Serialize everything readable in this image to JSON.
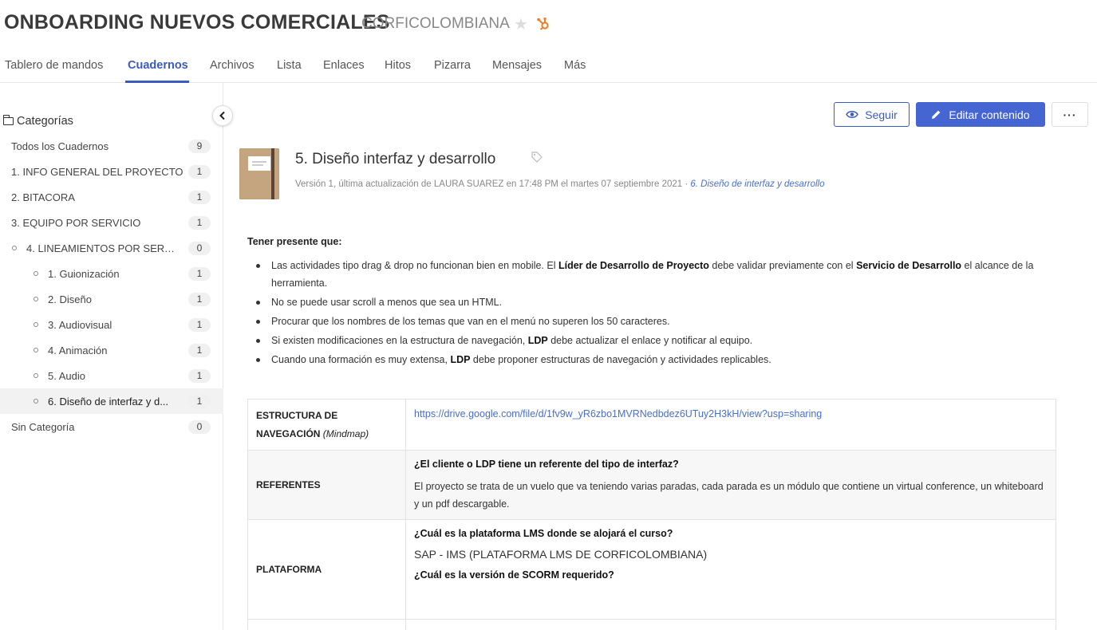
{
  "header": {
    "project_title": "ONBOARDING NUEVOS COMERCIALES",
    "company": "CORFICOLOMBIANA"
  },
  "tabs": [
    {
      "label": "Tablero de mandos"
    },
    {
      "label": "Cuadernos"
    },
    {
      "label": "Archivos"
    },
    {
      "label": "Lista"
    },
    {
      "label": "Enlaces"
    },
    {
      "label": "Hitos"
    },
    {
      "label": "Pizarra"
    },
    {
      "label": "Mensajes"
    },
    {
      "label": "Más"
    }
  ],
  "sidebar": {
    "heading": "Categorías",
    "items": [
      {
        "label": "Todos los Cuadernos",
        "count": "9"
      },
      {
        "label": "1. INFO GENERAL DEL PROYECTO",
        "count": "1"
      },
      {
        "label": "2. BITACORA",
        "count": "1"
      },
      {
        "label": "3. EQUIPO POR SERVICIO",
        "count": "1"
      },
      {
        "label": "4. LINEAMIENTOS POR SERVIR...",
        "count": "0"
      },
      {
        "label": "1. Guionización",
        "count": "1"
      },
      {
        "label": "2. Diseño",
        "count": "1"
      },
      {
        "label": "3. Audiovisual",
        "count": "1"
      },
      {
        "label": "4. Animación",
        "count": "1"
      },
      {
        "label": "5. Audio",
        "count": "1"
      },
      {
        "label": "6. Diseño de interfaz y d...",
        "count": "1"
      },
      {
        "label": "Sin Categoría",
        "count": "0"
      }
    ]
  },
  "actions": {
    "follow": "Seguir",
    "edit": "Editar contenido",
    "more": "···"
  },
  "document": {
    "title": "5. Diseño interfaz y desarrollo",
    "meta": "Versión 1, última actualización de LAURA SUAREZ en 17:48 PM el martes 07 septiembre 2021 · ",
    "category_link": "6. Diseño de interfaz y desarrollo"
  },
  "content": {
    "heading": "Tener presente que:",
    "notes": [
      {
        "a": "Las actividades tipo drag & drop no funcionan bien en mobile. El ",
        "b": "Líder de Desarrollo de Proyecto",
        "c": " debe validar previamente con el ",
        "d": "Servicio de Desarrollo",
        "e": " el alcance de la herramienta."
      },
      {
        "a": "No se puede usar scroll a menos que sea un HTML."
      },
      {
        "a": "Procurar que los nombres de los temas que van en el menú no superen los 50 caracteres."
      },
      {
        "a": "Si existen modificaciones en la estructura de navegación, ",
        "b": "LDP",
        "c": " debe actualizar el enlace y notificar al equipo."
      },
      {
        "a": "Cuando una formación es muy extensa, ",
        "b": "LDP",
        "c": " debe proponer estructuras de navegación y actividades replicables."
      }
    ]
  },
  "table": {
    "row1": {
      "label_main": "ESTRUCTURA DE NAVEGACIÓN",
      "label_note": "(Mindmap)",
      "link": "https://drive.google.com/file/d/1fv9w_yR6zbo1MVRNedbdez6UTuy2H3kH/view?usp=sharing"
    },
    "row2": {
      "label": "REFERENTES",
      "question": "¿El cliente o LDP tiene un referente del tipo de interfaz?",
      "answer": "El proyecto se trata de un vuelo que va teniendo varias paradas, cada parada es un módulo que contiene un virtual conference, un whiteboard y un pdf descargable."
    },
    "row3": {
      "label": "PLATAFORMA",
      "question1": "¿Cuál es la plataforma LMS donde se alojará el curso?",
      "answer1": "SAP - IMS (PLATAFORMA LMS DE CORFICOLOMBIANA)",
      "question2": "¿Cuál es la versión de SCORM requerido?"
    }
  },
  "colors": {
    "accent": "#3d5bbf",
    "primary_button": "#4465d2",
    "link": "#4a6fc7",
    "hubspot": "#f07b22",
    "notebook": "#c4a57f"
  }
}
